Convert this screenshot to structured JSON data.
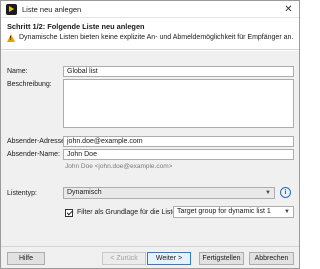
{
  "window": {
    "title": "Liste neu anlegen",
    "close_glyph": "✕",
    "app_icon": "app-logo-icon"
  },
  "header": {
    "step_title": "Schritt 1/2: Folgende Liste neu anlegen",
    "warning_text": "Dynamische Listen bieten keine explizite An- und Abmeldemöglichkeit für Empfänger an.",
    "warning_color": "#e9a100"
  },
  "form": {
    "name_label": "Name:",
    "name_value": "Global list",
    "description_label": "Beschreibung:",
    "description_value": "",
    "sender_address_label": "Absender-Adresse:",
    "sender_address_value": "john.doe@example.com",
    "sender_name_label": "Absender-Name:",
    "sender_name_value": "John Doe",
    "sender_preview": "John Doe <john.doe@example.com>",
    "list_type_label": "Listentyp:",
    "list_type_value": "Dynamisch",
    "info_glyph": "i",
    "filter_checkbox_label": "Filter als Grundlage für die Liste:",
    "filter_checked": true,
    "filter_value": "Target group for dynamic list 1"
  },
  "footer": {
    "help_label": "Hilfe",
    "back_label": "< Zurück",
    "next_label": "Weiter >",
    "finish_label": "Fertigstellen",
    "cancel_label": "Abbrechen",
    "accent_color": "#2b7bd9"
  }
}
